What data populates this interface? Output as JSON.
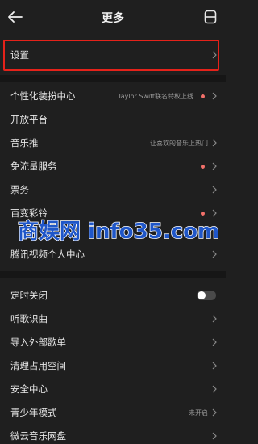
{
  "header": {
    "title": "更多",
    "back_icon": "arrow-left-icon",
    "right_icon": "scan-frame-icon"
  },
  "colors": {
    "background": "#1f1f1f",
    "highlight_border": "#e5221a",
    "dot": "#f2706a"
  },
  "settings": {
    "label": "设置"
  },
  "group1": [
    {
      "label": "个性化装扮中心",
      "sub": "Taylor Swift联名特权上线",
      "dot": true
    },
    {
      "label": "开放平台",
      "sub": "",
      "dot": false
    },
    {
      "label": "音乐推",
      "sub": "让喜欢的音乐上热门",
      "dot": false
    },
    {
      "label": "免流量服务",
      "sub": "",
      "dot": true
    },
    {
      "label": "票务",
      "sub": "",
      "dot": false
    },
    {
      "label": "百变彩铃",
      "sub": "",
      "dot": true
    },
    {
      "label": "腾讯视频个人中心",
      "sub": "",
      "dot": false
    }
  ],
  "group2": [
    {
      "label": "定时关闭",
      "toggle": true,
      "toggle_on": false
    },
    {
      "label": "听歌识曲"
    },
    {
      "label": "导入外部歌单"
    },
    {
      "label": "清理占用空间"
    },
    {
      "label": "安全中心"
    },
    {
      "label": "青少年模式",
      "sub": "未开启"
    },
    {
      "label": "微云音乐网盘"
    }
  ],
  "watermark": {
    "text": "商娱网 info35.com"
  }
}
